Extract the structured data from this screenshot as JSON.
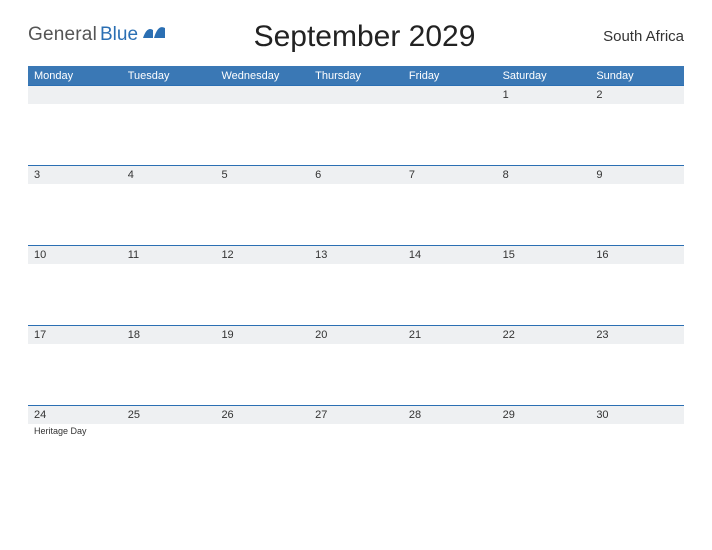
{
  "logo": {
    "part1": "General",
    "part2": "Blue"
  },
  "title": "September 2029",
  "region": "South Africa",
  "dow": [
    "Monday",
    "Tuesday",
    "Wednesday",
    "Thursday",
    "Friday",
    "Saturday",
    "Sunday"
  ],
  "weeks": [
    [
      {
        "n": ""
      },
      {
        "n": ""
      },
      {
        "n": ""
      },
      {
        "n": ""
      },
      {
        "n": ""
      },
      {
        "n": "1"
      },
      {
        "n": "2"
      }
    ],
    [
      {
        "n": "3"
      },
      {
        "n": "4"
      },
      {
        "n": "5"
      },
      {
        "n": "6"
      },
      {
        "n": "7"
      },
      {
        "n": "8"
      },
      {
        "n": "9"
      }
    ],
    [
      {
        "n": "10"
      },
      {
        "n": "11"
      },
      {
        "n": "12"
      },
      {
        "n": "13"
      },
      {
        "n": "14"
      },
      {
        "n": "15"
      },
      {
        "n": "16"
      }
    ],
    [
      {
        "n": "17"
      },
      {
        "n": "18"
      },
      {
        "n": "19"
      },
      {
        "n": "20"
      },
      {
        "n": "21"
      },
      {
        "n": "22"
      },
      {
        "n": "23"
      }
    ],
    [
      {
        "n": "24",
        "e": "Heritage Day"
      },
      {
        "n": "25"
      },
      {
        "n": "26"
      },
      {
        "n": "27"
      },
      {
        "n": "28"
      },
      {
        "n": "29"
      },
      {
        "n": "30"
      }
    ]
  ]
}
